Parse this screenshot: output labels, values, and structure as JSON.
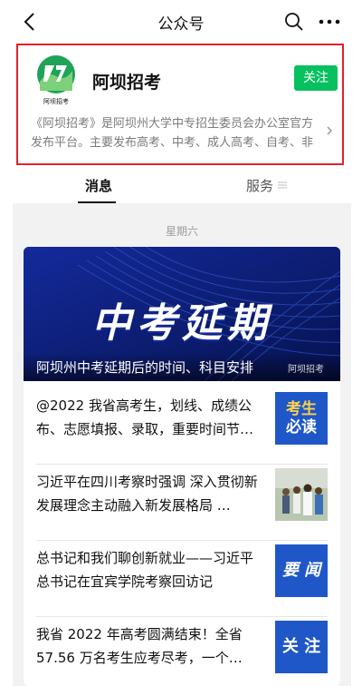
{
  "nav": {
    "title": "公众号",
    "back_icon": "chevron-left-icon",
    "search_icon": "search-icon",
    "more_icon": "more-dots-icon"
  },
  "profile": {
    "name": "阿坝招考",
    "logo_text": "阿坝招考",
    "follow_label": "关注",
    "description": "《阿坝招考》是阿坝州大学中专招生委员会办公室官方发布平台。主要发布高考、中考、成人高考、自考、非学…"
  },
  "tabs": {
    "messages": "消息",
    "services": "服务"
  },
  "feed": {
    "day_label": "星期六",
    "hero": {
      "headline": "中考延期",
      "caption": "阿坝州中考延期后的时间、科目安排",
      "source": "阿坝招考"
    },
    "items": [
      {
        "text": "@2022 我省高考生，划线、成绩公布、志愿填报、录取，重要时间节…",
        "thumb_text_1": "考生",
        "thumb_text_2": "必读"
      },
      {
        "text": "习近平在四川考察时强调 深入贯彻新发展理念主动融入新发展格局 …",
        "thumb_text_1": "",
        "thumb_text_2": ""
      },
      {
        "text": "总书记和我们聊创新就业——习近平总书记在宜宾学院考察回访记",
        "thumb_text_1": "要 闻",
        "thumb_text_2": ""
      },
      {
        "text": "我省 2022 年高考圆满结束！全省57.56 万名考生应考尽考，一个…",
        "thumb_text_1": "关 注",
        "thumb_text_2": ""
      }
    ]
  },
  "colors": {
    "follow_button": "#07c160",
    "highlight_border": "#e0232b",
    "hero_background": "#0b1e7a",
    "thumb_blue": "#1f57c8"
  }
}
